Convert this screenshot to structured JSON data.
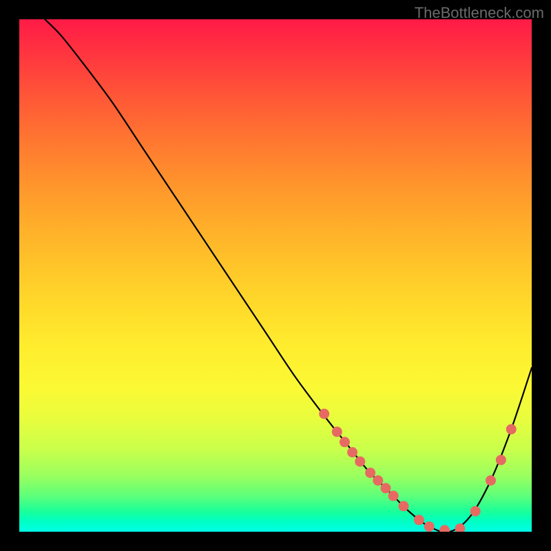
{
  "watermark": "TheBottleneck.com",
  "chart_data": {
    "type": "line",
    "title": "",
    "xlabel": "",
    "ylabel": "",
    "xlim": [
      0,
      100
    ],
    "ylim": [
      0,
      100
    ],
    "x": [
      5,
      8,
      12,
      18,
      24,
      30,
      36,
      42,
      48,
      54,
      60,
      64,
      68,
      72,
      76,
      80,
      84,
      88,
      92,
      96,
      100
    ],
    "y": [
      100,
      97,
      92,
      84,
      75,
      66,
      57,
      48,
      39,
      30,
      22,
      17,
      12,
      8,
      4,
      1,
      0,
      3,
      10,
      20,
      32
    ],
    "dot_points": {
      "x": [
        59.5,
        62,
        63.5,
        65,
        66.5,
        68.5,
        70,
        71.5,
        73,
        75,
        78,
        80,
        83,
        86,
        89,
        92,
        94,
        96
      ],
      "y": [
        23,
        19.5,
        17.5,
        15.5,
        13.7,
        11.5,
        10,
        8.5,
        7,
        5,
        2.3,
        1,
        0.3,
        0.6,
        4,
        10,
        14,
        20
      ]
    },
    "gradient_stops": [
      {
        "pos": 0,
        "color": "#ff1a47"
      },
      {
        "pos": 50,
        "color": "#ffd52a"
      },
      {
        "pos": 100,
        "color": "#00ffe6"
      }
    ]
  }
}
